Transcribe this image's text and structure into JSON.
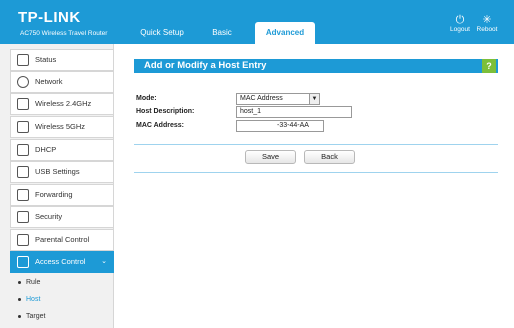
{
  "header": {
    "logo": "TP-LINK",
    "model": "AC750 Wireless Travel Router",
    "tabs": [
      "Quick Setup",
      "Basic",
      "Advanced"
    ],
    "logout_label": "Logout",
    "reboot_label": "Reboot",
    "brand_color": "#1d9ad6"
  },
  "sidebar": {
    "items": [
      {
        "label": "Status",
        "icon": "status-icon"
      },
      {
        "label": "Network",
        "icon": "globe-icon"
      },
      {
        "label": "Wireless 2.4GHz",
        "icon": "wireless-icon"
      },
      {
        "label": "Wireless 5GHz",
        "icon": "wireless-icon"
      },
      {
        "label": "DHCP",
        "icon": "monitor-icon"
      },
      {
        "label": "USB Settings",
        "icon": "usb-icon"
      },
      {
        "label": "Forwarding",
        "icon": "forwarding-icon"
      },
      {
        "label": "Security",
        "icon": "lock-icon"
      },
      {
        "label": "Parental Control",
        "icon": "parental-icon"
      },
      {
        "label": "Access Control",
        "icon": "access-control-icon"
      }
    ],
    "subitems": [
      "Rule",
      "Host",
      "Target"
    ]
  },
  "main": {
    "section_title": "Add or Modify a Host Entry",
    "help_label": "?",
    "mode_label": "Mode:",
    "mode_value": "MAC Address",
    "host_desc_label": "Host Description:",
    "host_desc_value": "host_1",
    "mac_label": "MAC Address:",
    "mac_value": "-33-44-AA",
    "save_label": "Save",
    "back_label": "Back",
    "help_color": "#7cbf3a"
  }
}
